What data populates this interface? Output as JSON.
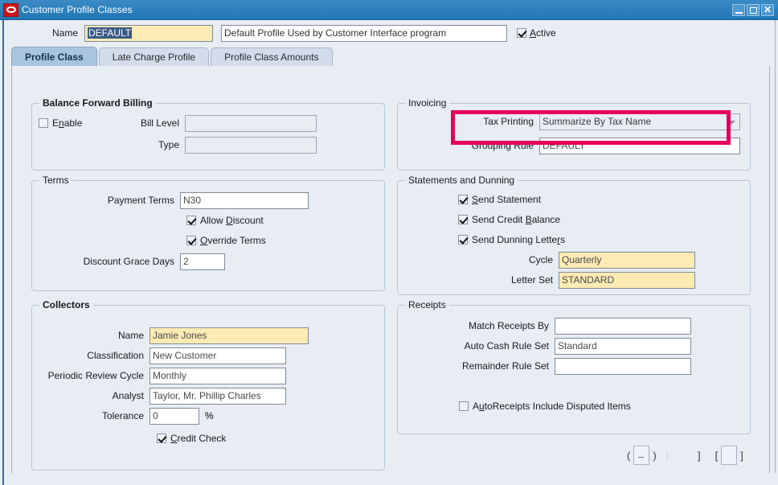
{
  "window": {
    "title": "Customer Profile Classes",
    "logo_icon": "oracle-logo-icon",
    "controls": {
      "minimize": "minimize-icon",
      "maximize": "maximize-icon",
      "close": "close-icon"
    },
    "titlebar_color": "#2176b5",
    "canvas_color": "#e8edf4"
  },
  "header": {
    "name_label": "Name",
    "name_value": "DEFAULT",
    "name_value_selected": true,
    "description_value": "Default Profile Used by Customer Interface program",
    "active_label": "Active",
    "active_checked": true
  },
  "tabs": [
    {
      "label": "Profile Class",
      "active": true
    },
    {
      "label": "Late Charge Profile",
      "active": false
    },
    {
      "label": "Profile Class Amounts",
      "active": false
    }
  ],
  "balance_forward_billing": {
    "legend": "Balance Forward Billing",
    "enable_label": "Enable",
    "enable_checked": false,
    "bill_level_label": "Bill Level",
    "bill_level_value": "",
    "type_label": "Type",
    "type_value": ""
  },
  "invoicing": {
    "legend": "Invoicing",
    "tax_printing_label": "Tax Printing",
    "tax_printing_value": "Summarize By Tax Name",
    "grouping_rule_label": "Grouping Rule",
    "grouping_rule_value": "DEFAULT"
  },
  "terms": {
    "legend": "Terms",
    "payment_terms_label": "Payment Terms",
    "payment_terms_value": "N30",
    "allow_discount_label": "Allow Discount",
    "allow_discount_checked": true,
    "override_terms_label": "Override Terms",
    "override_terms_checked": true,
    "discount_grace_days_label": "Discount Grace Days",
    "discount_grace_days_value": "2"
  },
  "statements_and_dunning": {
    "legend": "Statements and Dunning",
    "send_statement_label": "Send Statement",
    "send_statement_checked": true,
    "send_credit_balance_label": "Send Credit Balance",
    "send_credit_balance_checked": true,
    "send_dunning_letters_label": "Send Dunning Letters",
    "send_dunning_letters_checked": true,
    "cycle_label": "Cycle",
    "cycle_value": "Quarterly",
    "letter_set_label": "Letter Set",
    "letter_set_value": "STANDARD"
  },
  "collectors": {
    "legend": "Collectors",
    "name_label": "Name",
    "name_value": "Jamie Jones",
    "classification_label": "Classification",
    "classification_value": "New Customer",
    "periodic_review_cycle_label": "Periodic Review Cycle",
    "periodic_review_cycle_value": "Monthly",
    "analyst_label": "Analyst",
    "analyst_value": "Taylor, Mr. Phillip Charles",
    "tolerance_label": "Tolerance",
    "tolerance_value": "0",
    "tolerance_unit": "%",
    "credit_check_label": "Credit Check",
    "credit_check_checked": true
  },
  "receipts": {
    "legend": "Receipts",
    "match_receipts_by_label": "Match Receipts By",
    "match_receipts_by_value": "",
    "auto_cash_rule_set_label": "Auto Cash Rule Set",
    "auto_cash_rule_set_value": "Standard",
    "remainder_rule_set_label": "Remainder Rule Set",
    "remainder_rule_set_value": "",
    "autoreceipts_label": "AutoReceipts Include Disputed Items",
    "autoreceipts_checked": false
  },
  "bottom_buttons": {
    "left_open_paren": "(",
    "left_close_paren": ")",
    "separator": "|",
    "mid_bracket": "]",
    "right_open_bracket": "[",
    "right_close_bracket": "]"
  },
  "annotation": {
    "color": "#e4005a",
    "target": "grouping-rule-field"
  }
}
